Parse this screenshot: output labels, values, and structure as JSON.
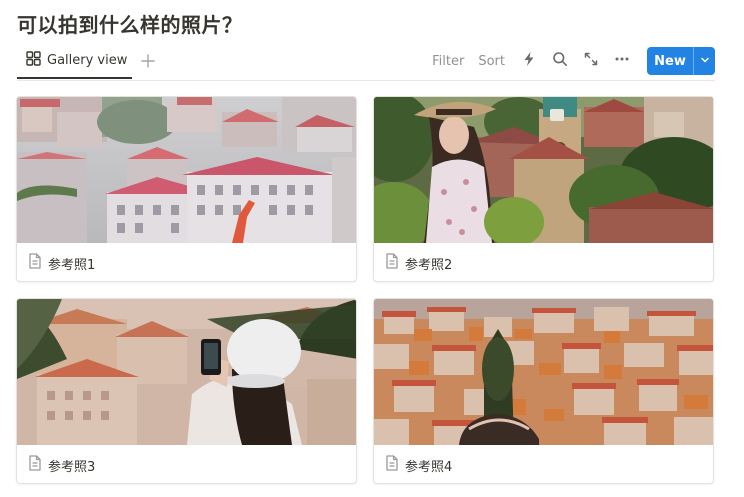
{
  "page": {
    "title": "可以拍到什么样的照片？"
  },
  "tabs": {
    "gallery_label": "Gallery view",
    "add_icon": "plus-icon",
    "gallery_icon": "grid-icon"
  },
  "toolbar": {
    "filter_label": "Filter",
    "sort_label": "Sort",
    "icons": [
      "lightning-icon",
      "search-icon",
      "expand-icon",
      "more-icon",
      "chevron-down-icon"
    ],
    "new_label": "New",
    "accent": "#2383e2"
  },
  "cards": [
    {
      "name": "参考照1",
      "icon": "page-icon"
    },
    {
      "name": "参考照2",
      "icon": "page-icon"
    },
    {
      "name": "参考照3",
      "icon": "page-icon"
    },
    {
      "name": "参考照4",
      "icon": "page-icon"
    }
  ]
}
